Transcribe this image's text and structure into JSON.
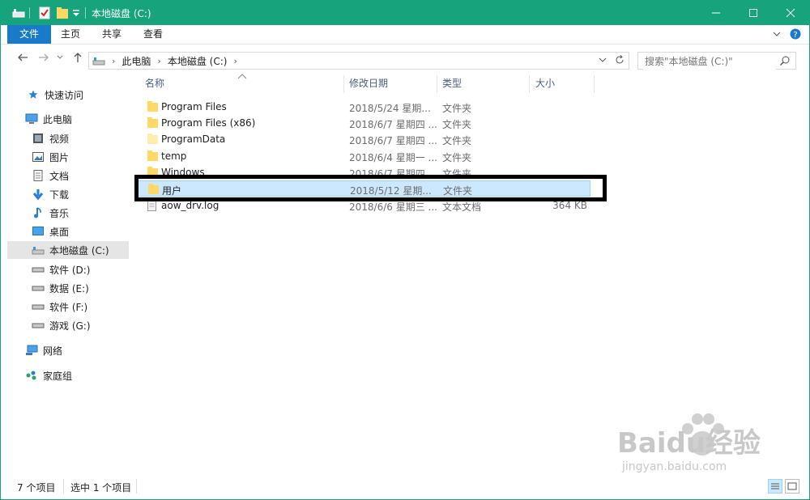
{
  "window": {
    "title": "本地磁盘 (C:)",
    "accent": "#17a37c"
  },
  "title_controls": [
    "minimize-button",
    "maximize-button",
    "close-button"
  ],
  "ribbon": {
    "tabs": [
      "文件",
      "主页",
      "共享",
      "查看"
    ]
  },
  "address": {
    "crumbs": [
      "此电脑",
      "本地磁盘 (C:)"
    ],
    "search_placeholder": "搜索\"本地磁盘 (C:)\""
  },
  "sidebar": {
    "items": [
      {
        "label": "快速访问",
        "icon": "star-icon"
      },
      {
        "label": "此电脑",
        "icon": "computer-icon"
      },
      {
        "label": "视频",
        "icon": "video-icon"
      },
      {
        "label": "图片",
        "icon": "pictures-icon"
      },
      {
        "label": "文档",
        "icon": "document-icon"
      },
      {
        "label": "下载",
        "icon": "download-icon"
      },
      {
        "label": "音乐",
        "icon": "music-icon"
      },
      {
        "label": "桌面",
        "icon": "desktop-icon"
      },
      {
        "label": "本地磁盘 (C:)",
        "icon": "drive-c-icon",
        "active": true
      },
      {
        "label": "软件 (D:)",
        "icon": "drive-icon"
      },
      {
        "label": "数据 (E:)",
        "icon": "drive-icon"
      },
      {
        "label": "软件 (F:)",
        "icon": "drive-icon"
      },
      {
        "label": "游戏 (G:)",
        "icon": "drive-icon"
      },
      {
        "label": "网络",
        "icon": "network-icon"
      },
      {
        "label": "家庭组",
        "icon": "homegroup-icon"
      }
    ]
  },
  "columns": [
    "名称",
    "修改日期",
    "类型",
    "大小"
  ],
  "files": [
    {
      "name": "Program Files",
      "date": "2018/5/24 星期...",
      "type": "文件夹",
      "size": "",
      "icon": "folder-icon"
    },
    {
      "name": "Program Files (x86)",
      "date": "2018/6/7 星期四 ...",
      "type": "文件夹",
      "size": "",
      "icon": "folder-icon"
    },
    {
      "name": "ProgramData",
      "date": "2018/6/7 星期四 ...",
      "type": "文件夹",
      "size": "",
      "icon": "folder-icon"
    },
    {
      "name": "temp",
      "date": "2018/6/4 星期一 ...",
      "type": "文件夹",
      "size": "",
      "icon": "folder-icon"
    },
    {
      "name": "Windows",
      "date": "2018/6/7 星期四 ...",
      "type": "文件夹",
      "size": "",
      "icon": "folder-icon"
    },
    {
      "name": "用户",
      "date": "2018/5/12 星期...",
      "type": "文件夹",
      "size": "",
      "icon": "folder-icon",
      "selected": true
    },
    {
      "name": "aow_drv.log",
      "date": "2018/6/6 星期三 ...",
      "type": "文本文档",
      "size": "364 KB",
      "icon": "text-file-icon"
    }
  ],
  "status": {
    "count": "7 个项目",
    "selected": "选中 1 个项目"
  },
  "watermark": {
    "brand": "Baidu经验",
    "url": "jingyan.baidu.com"
  }
}
